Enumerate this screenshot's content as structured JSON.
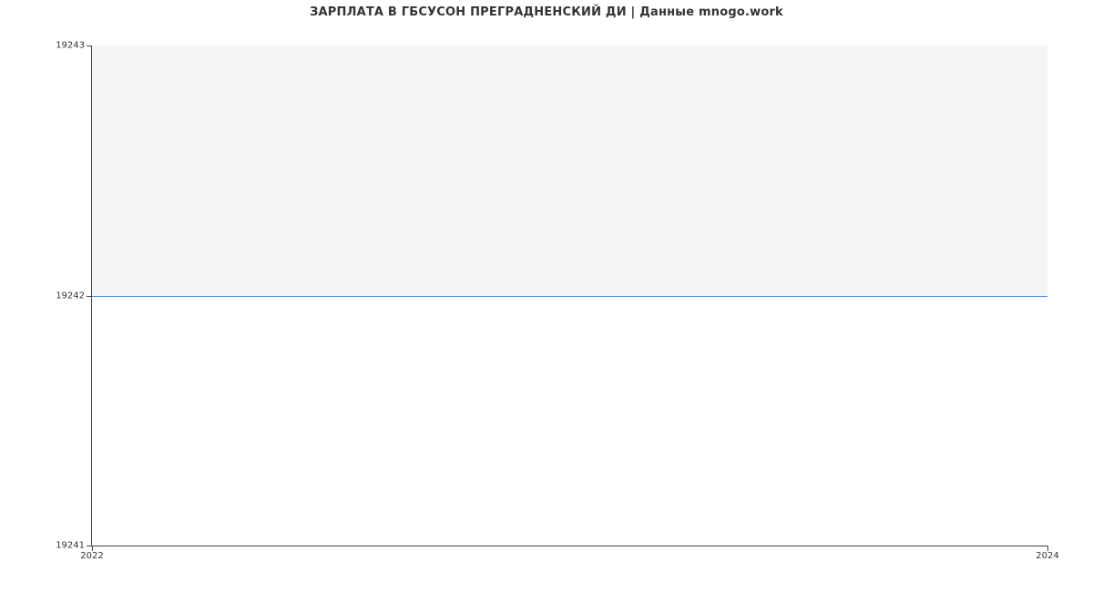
{
  "chart_data": {
    "type": "area",
    "title": "ЗАРПЛАТА В ГБСУСОН ПРЕГРАДНЕНСКИЙ ДИ | Данные mnogo.work",
    "xlabel": "",
    "ylabel": "",
    "x": [
      2022,
      2024
    ],
    "values": [
      19242,
      19242
    ],
    "xlim": [
      2022,
      2024
    ],
    "ylim": [
      19241,
      19243
    ],
    "y_ticks": [
      19241,
      19242,
      19243
    ],
    "x_ticks": [
      2022,
      2024
    ],
    "line_color": "#4a8ee6",
    "fill_color": "#f4f4f4"
  }
}
